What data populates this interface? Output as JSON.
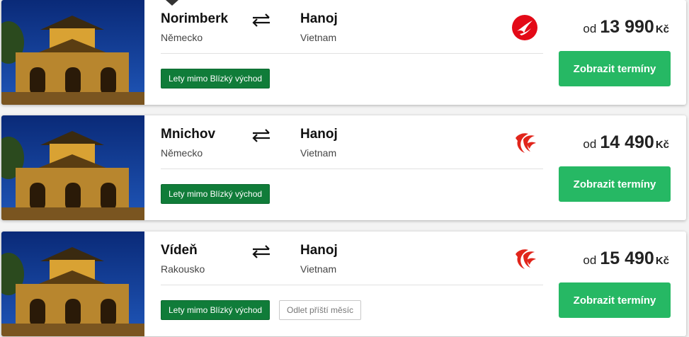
{
  "flights": [
    {
      "from_city": "Norimberk",
      "from_country": "Německo",
      "to_city": "Hanoj",
      "to_country": "Vietnam",
      "airline_icon": "turkish-airlines-logo-icon",
      "price_prefix": "od",
      "price": "13 990",
      "currency": "Kč",
      "button_label": "Zobrazit termíny",
      "tags": [
        "Lety mimo Blízký východ"
      ]
    },
    {
      "from_city": "Mnichov",
      "from_country": "Německo",
      "to_city": "Hanoj",
      "to_country": "Vietnam",
      "airline_icon": "air-china-logo-icon",
      "price_prefix": "od",
      "price": "14 490",
      "currency": "Kč",
      "button_label": "Zobrazit termíny",
      "tags": [
        "Lety mimo Blízký východ"
      ]
    },
    {
      "from_city": "Vídeň",
      "from_country": "Rakousko",
      "to_city": "Hanoj",
      "to_country": "Vietnam",
      "airline_icon": "air-china-logo-icon",
      "price_prefix": "od",
      "price": "15 490",
      "currency": "Kč",
      "button_label": "Zobrazit termíny",
      "tags": [
        "Lety mimo Blízký východ",
        "Odlet příští měsíc"
      ]
    }
  ],
  "colors": {
    "button_green": "#26b864",
    "tag_green": "#107c39",
    "turkish_red": "#e30a17",
    "air_china_red": "#e1251b"
  }
}
